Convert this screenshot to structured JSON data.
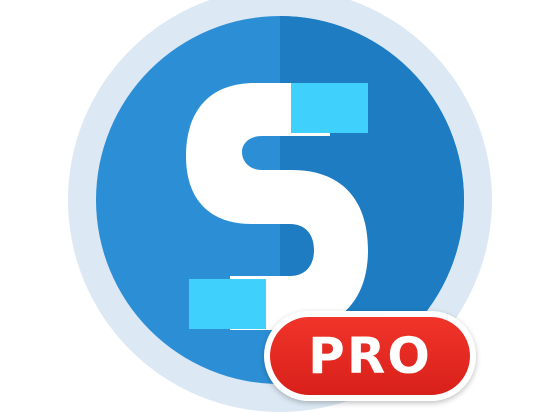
{
  "app_icon": {
    "badge_label": "PRO",
    "colors": {
      "outer_ring": "#dce9f4",
      "disc_left": "#2c8fd6",
      "disc_right": "#1e7cc2",
      "glyph": "#ffffff",
      "tile": "#3fd0fc",
      "badge": "#e42c22",
      "badge_text": "#ffffff"
    }
  }
}
